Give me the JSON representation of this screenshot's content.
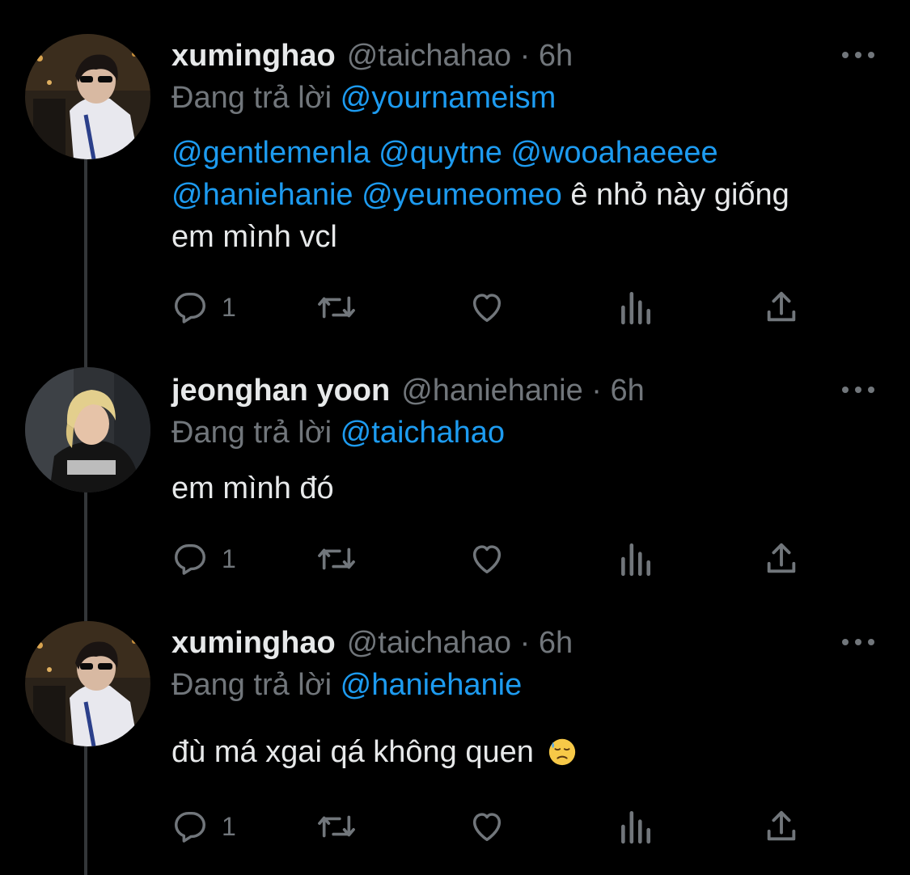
{
  "replying_prefix": "Đang trả lời",
  "tweets": [
    {
      "name": "xuminghao",
      "handle_time": "@taichahao · 6h",
      "replying_to": "@yournameism",
      "body": {
        "mentions_line1": "@gentlemenla @quytne @wooahaeeee",
        "mentions_line2": "@haniehanie @yeumeomeo",
        "text_line2": " ê nhỏ này giống",
        "text_line3": "em mình vcl"
      },
      "reply_count": "1",
      "avatar": "avatar-photo"
    },
    {
      "name": "jeonghan yoon",
      "handle_time": "@haniehanie · 6h",
      "replying_to": "@taichahao",
      "body": {
        "text": "em mình đó"
      },
      "reply_count": "1",
      "avatar": "avatar-photo"
    },
    {
      "name": "xuminghao",
      "handle_time": "@taichahao · 6h",
      "replying_to": "@haniehanie",
      "body": {
        "text": "đù má xgai qá không quen",
        "emoji": "downcast-face-with-sweat-emoji"
      },
      "reply_count": "1",
      "avatar": "avatar-photo"
    }
  ],
  "icons": [
    "reply-icon",
    "retweet-icon",
    "like-icon",
    "views-icon",
    "share-icon",
    "more-icon"
  ],
  "colors": {
    "background": "#000000",
    "text": "#e7e9ea",
    "muted": "#71767b",
    "link": "#1d9bf0",
    "thread_line": "#333639"
  }
}
